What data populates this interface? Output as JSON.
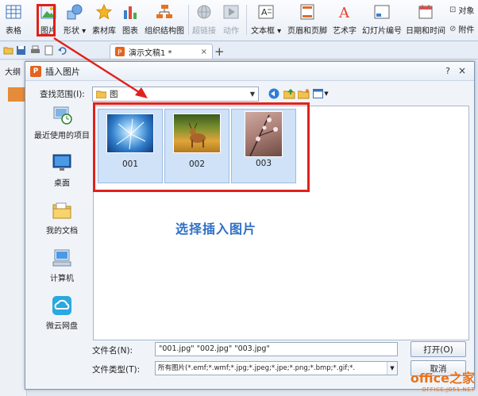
{
  "ribbon": {
    "items": [
      {
        "label": "表格",
        "icon": "table-icon"
      },
      {
        "label": "图片",
        "icon": "picture-icon"
      },
      {
        "label": "形状",
        "icon": "shapes-icon"
      },
      {
        "label": "素材库",
        "icon": "star-icon"
      },
      {
        "label": "图表",
        "icon": "chart-icon"
      },
      {
        "label": "组织结构图",
        "icon": "org-chart-icon"
      },
      {
        "label": "超链接",
        "icon": "hyperlink-icon"
      },
      {
        "label": "动作",
        "icon": "action-icon"
      },
      {
        "label": "文本框",
        "icon": "textbox-icon"
      },
      {
        "label": "页眉和页脚",
        "icon": "header-footer-icon"
      },
      {
        "label": "艺术字",
        "icon": "wordart-icon"
      },
      {
        "label": "幻灯片编号",
        "icon": "slide-number-icon"
      },
      {
        "label": "日期和时间",
        "icon": "date-time-icon"
      },
      {
        "label": "对象",
        "icon": "object-icon"
      },
      {
        "label": "附件",
        "icon": "attachment-icon"
      }
    ]
  },
  "tabs": {
    "document": "演示文稿1 *",
    "new_tab": "+",
    "close": "×"
  },
  "side": {
    "label": "大纲"
  },
  "dialog": {
    "title": "插入图片",
    "help": "?",
    "close": "×",
    "look_in_label": "查找范围(I):",
    "look_in_value": "图",
    "places": [
      "最近使用的项目",
      "桌面",
      "我的文档",
      "计算机",
      "微云网盘"
    ],
    "files": [
      {
        "name": "001"
      },
      {
        "name": "002"
      },
      {
        "name": "003"
      }
    ],
    "filename_label": "文件名(N):",
    "filename_value": "\"001.jpg\" \"002.jpg\" \"003.jpg\"",
    "filetype_label": "文件类型(T):",
    "filetype_value": "所有图片(*.emf;*.wmf;*.jpg;*.jpeg;*.jpe;*.png;*.bmp;*.gif;*.",
    "open_button": "打开(O)",
    "cancel_button": "取消"
  },
  "annotation": "选择插入图片",
  "watermark": {
    "line1": "office之家",
    "line2": "OFFICE.JB51.NET"
  },
  "colors": {
    "accent_red": "#e0221b",
    "annotation_blue": "#2d6fc8",
    "watermark_orange": "#e8731c"
  }
}
